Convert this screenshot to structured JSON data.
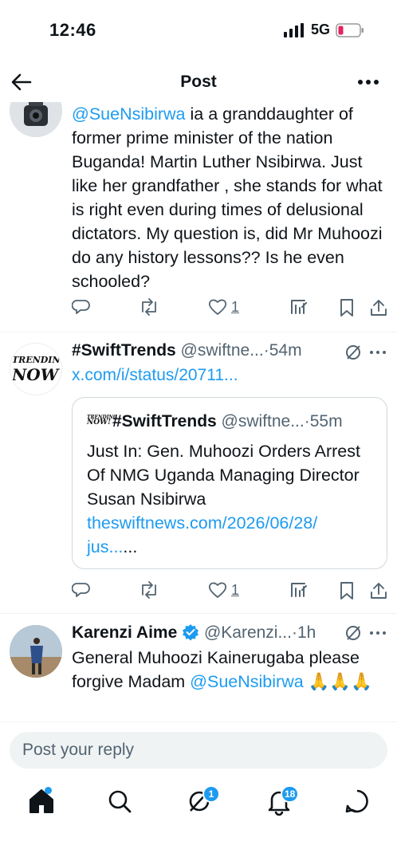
{
  "status_bar": {
    "time": "12:46",
    "network": "5G"
  },
  "header": {
    "title": "Post"
  },
  "posts": [
    {
      "mention": "@SueNsibirwa",
      "text": " ia a granddaughter of former prime minister of the nation Buganda! Martin Luther Nsibirwa. Just like her grandfather , she stands for what is right even during times of delusional dictators. My question is, did Mr Muhoozi do any history lessons?? Is he even schooled?",
      "likes": "1"
    },
    {
      "author": "#SwiftTrends",
      "handle": "@swiftne...",
      "time": "54m",
      "link": "x.com/i/status/20711...",
      "avatar_text_1": "TRENDING",
      "avatar_text_2": "NOW!",
      "likes": "1",
      "quote": {
        "author": "#SwiftTrends",
        "handle": "@swiftne...",
        "time": "55m",
        "text": "Just In: Gen. Muhoozi Orders Arrest Of NMG Uganda Managing Director Susan Nsibirwa",
        "link_1": "theswiftnews.com/2026/06/28/",
        "link_2": "jus...",
        "link_suffix": "..."
      }
    },
    {
      "author": "Karenzi Aime",
      "handle": "@Karenzi...",
      "time": "1h",
      "text_before": "General Muhoozi Kainerugaba please forgive Madam ",
      "mention": "@SueNsibirwa",
      "emoji": " 🙏🙏🙏"
    }
  ],
  "meta_separator": "·",
  "reply": {
    "placeholder": "Post your reply"
  },
  "nav": {
    "grok_badge": "1",
    "notifications_badge": "18"
  },
  "colors": {
    "accent": "#1d9bf0",
    "text": "#0f1419",
    "muted": "#536471"
  },
  "icons": [
    "signal-icon",
    "battery-icon",
    "back-arrow-icon",
    "more-icon",
    "reply-icon",
    "repost-icon",
    "like-icon",
    "views-icon",
    "bookmark-icon",
    "share-icon",
    "grok-icon",
    "verified-icon",
    "home-icon",
    "search-icon",
    "notifications-icon",
    "messages-icon"
  ]
}
